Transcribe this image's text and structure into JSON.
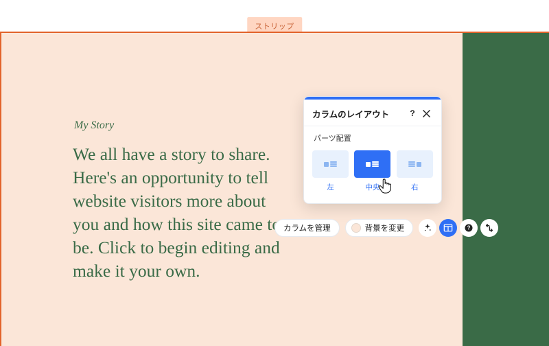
{
  "strip_label": "ストリップ",
  "content": {
    "heading": "My Story",
    "body": "We all have a story to share. Here's an opportunity to tell website visitors more about you and how this site came to be. Click to begin editing and make it your own."
  },
  "popover": {
    "title": "カラムのレイアウト",
    "section_label": "パーツ配置",
    "options": [
      {
        "label": "左",
        "selected": false
      },
      {
        "label": "中央",
        "selected": true
      },
      {
        "label": "右",
        "selected": false
      }
    ]
  },
  "actionbar": {
    "manage_columns": "カラムを管理",
    "change_bg": "背景を変更",
    "swatch_color": "#fbe6d8"
  },
  "colors": {
    "accent": "#2f6ff5",
    "strip_border": "#e2632a",
    "left_bg": "#fbe6d8",
    "right_bg": "#3a6b47"
  }
}
